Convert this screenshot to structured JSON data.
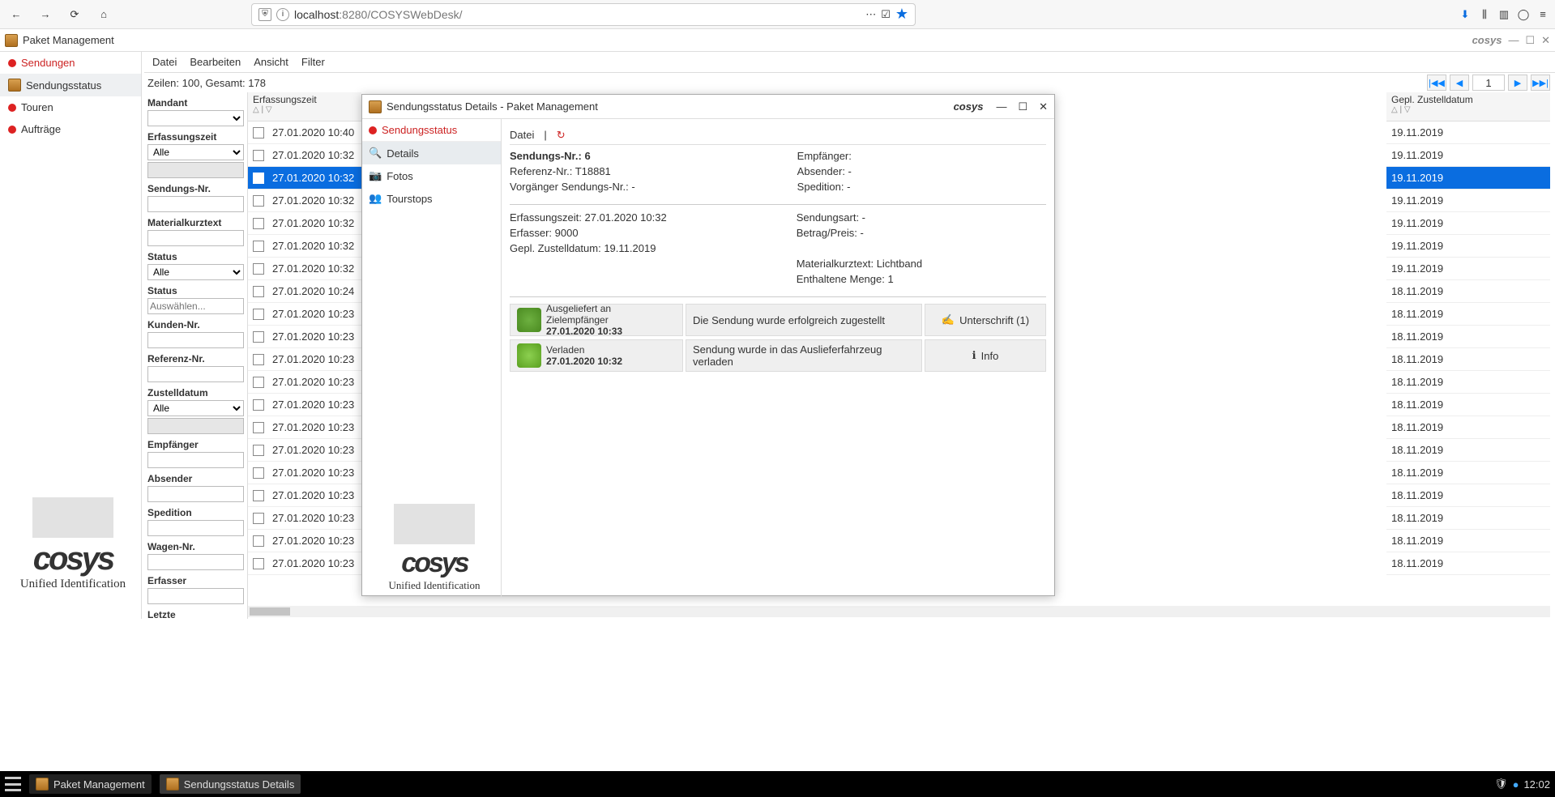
{
  "browser": {
    "url_host": "localhost",
    "url_port": ":8280",
    "url_path": "/COSYSWebDesk/"
  },
  "app": {
    "title": "Paket Management",
    "logo_text": "cosys",
    "logo_tag": "Unified Identification"
  },
  "nav": {
    "sendungen": "Sendungen",
    "sendungsstatus": "Sendungsstatus",
    "touren": "Touren",
    "auftraege": "Aufträge"
  },
  "menu": {
    "datei": "Datei",
    "bearbeiten": "Bearbeiten",
    "ansicht": "Ansicht",
    "filter": "Filter"
  },
  "rowcount": "Zeilen: 100, Gesamt: 178",
  "pager": {
    "num": "1"
  },
  "filters": {
    "mandant": "Mandant",
    "erfassungszeit": "Erfassungszeit",
    "alle": "Alle",
    "sendungsnr": "Sendungs-Nr.",
    "materialkurztext": "Materialkurztext",
    "status": "Status",
    "status2": "Status",
    "auswaehlen": "Auswählen...",
    "kundennr": "Kunden-Nr.",
    "referenznr": "Referenz-Nr.",
    "zustelldatum": "Zustelldatum",
    "empfaenger": "Empfänger",
    "absender": "Absender",
    "spedition": "Spedition",
    "wagennr": "Wagen-Nr.",
    "erfasser": "Erfasser",
    "letzte": "Letzte"
  },
  "col_left": "Erfassungszeit",
  "col_right": "Gepl. Zustelldatum",
  "rows_left": [
    "27.01.2020 10:40",
    "27.01.2020 10:32",
    "27.01.2020 10:32",
    "27.01.2020 10:32",
    "27.01.2020 10:32",
    "27.01.2020 10:32",
    "27.01.2020 10:32",
    "27.01.2020 10:24",
    "27.01.2020 10:23",
    "27.01.2020 10:23",
    "27.01.2020 10:23",
    "27.01.2020 10:23",
    "27.01.2020 10:23",
    "27.01.2020 10:23",
    "27.01.2020 10:23",
    "27.01.2020 10:23",
    "27.01.2020 10:23",
    "27.01.2020 10:23",
    "27.01.2020 10:23",
    "27.01.2020 10:23"
  ],
  "rows_right": [
    "19.11.2019",
    "19.11.2019",
    "19.11.2019",
    "19.11.2019",
    "19.11.2019",
    "19.11.2019",
    "19.11.2019",
    "18.11.2019",
    "18.11.2019",
    "18.11.2019",
    "18.11.2019",
    "18.11.2019",
    "18.11.2019",
    "18.11.2019",
    "18.11.2019",
    "18.11.2019",
    "18.11.2019",
    "18.11.2019",
    "18.11.2019",
    "18.11.2019"
  ],
  "selected_index": 2,
  "dialog": {
    "title": "Sendungsstatus Details - Paket Management",
    "tab_status": "Sendungsstatus",
    "nav_details": "Details",
    "nav_fotos": "Fotos",
    "nav_tourstops": "Tourstops",
    "menu_datei": "Datei",
    "info": {
      "sendungsnr_lbl": "Sendungs-Nr.: ",
      "sendungsnr_val": "6",
      "referenznr_lbl": "Referenz-Nr.: ",
      "referenznr_val": "T18881",
      "vorg_lbl": "Vorgänger Sendungs-Nr.: ",
      "vorg_val": "-",
      "empf_lbl": "Empfänger:",
      "empf_val": "",
      "abs_lbl": "Absender: ",
      "abs_val": "-",
      "sped_lbl": "Spedition: ",
      "sped_val": "-",
      "erfzeit_lbl": "Erfassungszeit: ",
      "erfzeit_val": "27.01.2020 10:32",
      "erfasser_lbl": "Erfasser: ",
      "erfasser_val": "9000",
      "zustell_lbl": "Gepl. Zustelldatum: ",
      "zustell_val": "19.11.2019",
      "sendart_lbl": "Sendungsart: ",
      "sendart_val": "-",
      "betrag_lbl": "Betrag/Preis: ",
      "betrag_val": "-",
      "material_lbl": "Materialkurztext: ",
      "material_val": "Lichtband",
      "menge_lbl": "Enthaltene Menge: ",
      "menge_val": "1"
    },
    "events": [
      {
        "title": "Ausgeliefert an Zielempfänger",
        "ts": "27.01.2020 10:33",
        "desc": "Die Sendung wurde erfolgreich zugestellt",
        "action": "Unterschrift (1)"
      },
      {
        "title": "Verladen",
        "ts": "27.01.2020 10:32",
        "desc": "Sendung wurde in das Auslieferfahrzeug verladen",
        "action": "Info"
      }
    ]
  },
  "taskbar": {
    "t1": "Paket Management",
    "t2": "Sendungsstatus Details",
    "clock": "12:02"
  }
}
